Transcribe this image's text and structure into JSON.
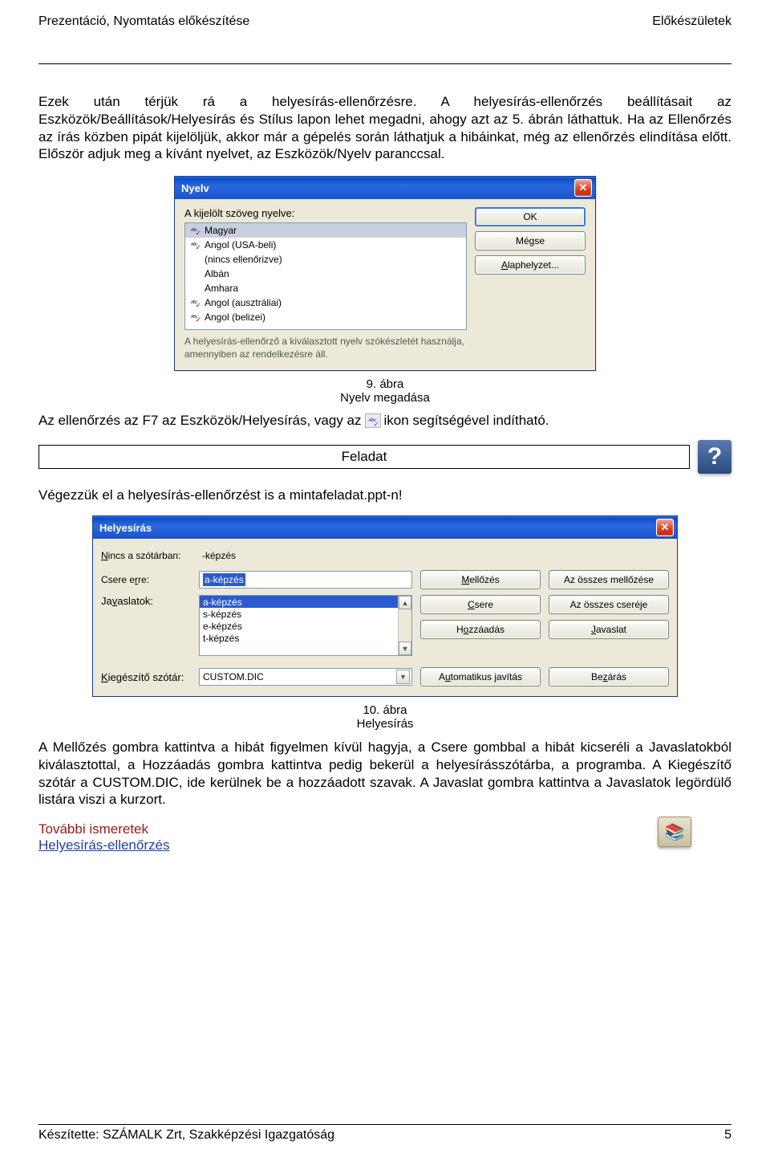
{
  "header": {
    "left": "Prezentáció, Nyomtatás előkészítése",
    "right": "Előkészületek"
  },
  "para1": "Ezek után térjük rá a helyesírás-ellenőrzésre. A helyesírás-ellenőrzés beállításait az Eszközök/Beállítások/Helyesírás és Stílus lapon lehet megadni, ahogy azt az 5. ábrán láthattuk. Ha az Ellenőrzés az írás közben pipát kijelöljük, akkor már a gépelés során láthatjuk a hibáinkat, még az ellenőrzés elindítása előtt. Először adjuk meg a kívánt nyelvet, az Eszközök/Nyelv paranccsal.",
  "dlg1": {
    "title": "Nyelv",
    "label": "A kijelölt szöveg nyelve:",
    "items": [
      {
        "icon": true,
        "text": "Magyar",
        "selected": true
      },
      {
        "icon": true,
        "text": "Angol (USA-beli)"
      },
      {
        "icon": false,
        "text": "(nincs ellenőrizve)"
      },
      {
        "icon": false,
        "text": "Albán"
      },
      {
        "icon": false,
        "text": "Amhara"
      },
      {
        "icon": true,
        "text": "Angol (ausztráliai)"
      },
      {
        "icon": true,
        "text": "Angol (belizei)"
      }
    ],
    "hint": "A helyesírás-ellenőrző a kiválasztott nyelv szókészletét használja, amennyiben az rendelkezésre áll.",
    "buttons": {
      "ok": "OK",
      "cancel": "Mégse",
      "default": "Alaphelyzet..."
    }
  },
  "caption1": {
    "num": "9. ábra",
    "text": "Nyelv megadása"
  },
  "para2": {
    "a": "Az ellenőrzés az F7 az Eszközök/Helyesírás, vagy az",
    "b": "ikon segítségével indítható."
  },
  "feladat": "Feladat",
  "para3": "Végezzük el a helyesírás-ellenőrzést is a mintafeladat.ppt-n!",
  "dlg2": {
    "title": "Helyesírás",
    "labels": {
      "notindict": "Nincs a szótárban:",
      "changeto": "Csere erre:",
      "suggestions": "Javaslatok:",
      "customdict": "Kiegészítő szótár:"
    },
    "notindict_val": "-képzés",
    "changeto_val": "a-képzés",
    "suggestions_list": [
      "a-képzés",
      "s-képzés",
      "e-képzés",
      "t-képzés"
    ],
    "customdict_val": "CUSTOM.DIC",
    "buttons": {
      "ignore": "Mellőzés",
      "ignoreall": "Az összes mellőzése",
      "change": "Csere",
      "changeall": "Az összes cseréje",
      "add": "Hozzáadás",
      "suggest": "Javaslat",
      "autocorrect": "Automatikus javítás",
      "close": "Bezárás"
    }
  },
  "caption2": {
    "num": "10. ábra",
    "text": "Helyesírás"
  },
  "para4": "A Mellőzés gombra kattintva a hibát figyelmen kívül hagyja, a Csere gombbal a hibát kicseréli a Javaslatokból kiválasztottal, a Hozzáadás gombra kattintva pedig bekerül a helyesírásszótárba, a programba. A Kiegészítő szótár a CUSTOM.DIC, ide kerülnek be a hozzáadott szavak. A Javaslat gombra kattintva a Javaslatok legördülő listára viszi a kurzort.",
  "refs": {
    "more": "További ismeretek",
    "link": "Helyesírás-ellenőrzés"
  },
  "footer": {
    "left": "Készítette: SZÁMALK Zrt, Szakképzési Igazgatóság",
    "right": "5"
  }
}
